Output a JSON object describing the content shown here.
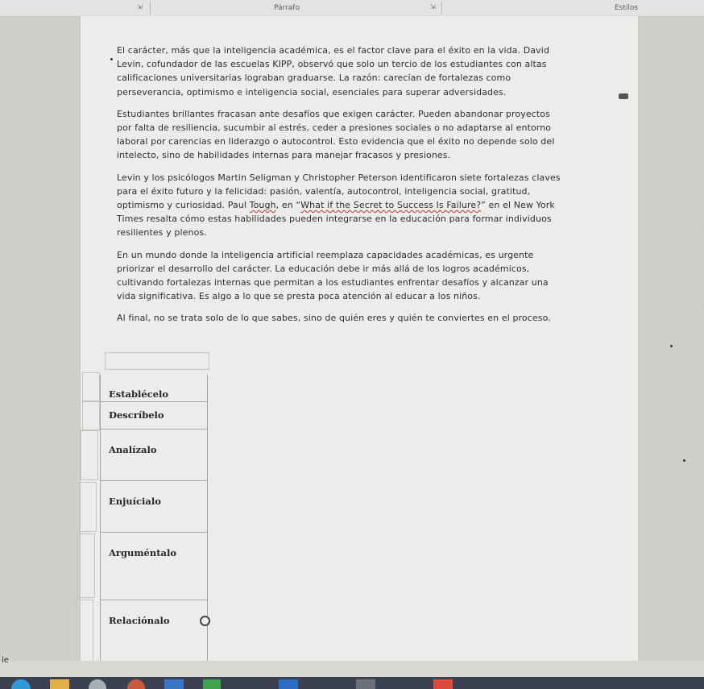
{
  "ribbon": {
    "paragraph_group": "Párrafo",
    "styles_group": "Estilos"
  },
  "document": {
    "paragraphs": [
      "El carácter, más que la inteligencia académica, es el factor clave para el éxito en la vida. David Levin, cofundador de las escuelas KIPP, observó que solo un tercio de los estudiantes con altas calificaciones universitarias lograban graduarse. La razón: carecían de fortalezas como perseverancia, optimismo e inteligencia social, esenciales para superar adversidades.",
      "Estudiantes brillantes fracasan ante desafíos que exigen carácter. Pueden abandonar proyectos por falta de resiliencia, sucumbir al estrés, ceder a presiones sociales o no adaptarse al entorno laboral por carencias en liderazgo o autocontrol. Esto evidencia que el éxito no depende solo del intelecto, sino de habilidades internas para manejar fracasos y presiones."
    ],
    "p3": {
      "before": "Levin y los psicólogos Martin Seligman y Christopher Peterson identificaron siete fortalezas claves para el éxito futuro y la felicidad: pasión, valentía, autocontrol, inteligencia social, gratitud, optimismo y curiosidad. Paul ",
      "tough": "Tough",
      "middle": ", en “",
      "article": "What if the Secret to Success Is Failure?",
      "after": "” en el New York Times resalta cómo estas habilidades pueden integrarse en la educación para formar individuos resilientes y plenos."
    },
    "p4": "En un mundo donde la inteligencia artificial reemplaza capacidades académicas, es urgente priorizar el desarrollo del carácter. La educación debe ir más allá de los logros académicos, cultivando fortalezas internas que permitan a los estudiantes enfrentar desafíos y alcanzar una vida significativa. Es algo a lo que se presta poca atención al educar a los niños.",
    "p5": "Al final, no se trata solo de lo que sabes, sino de quién eres y quién te conviertes en el proceso."
  },
  "verb_table": [
    "Establécelo",
    "Descríbelo",
    "Analízalo",
    "Enjuícialo",
    "Arguméntalo",
    "Relaciónalo"
  ],
  "status_bar": {
    "left_text": "le"
  },
  "icons": {
    "launcher": "dialog-launcher-icon",
    "comment": "comment-icon",
    "handle": "resize-handle-icon"
  },
  "colors": {
    "page": "#ececea",
    "taskbar": "#3b4150",
    "spellcheck": "#c0392b"
  }
}
